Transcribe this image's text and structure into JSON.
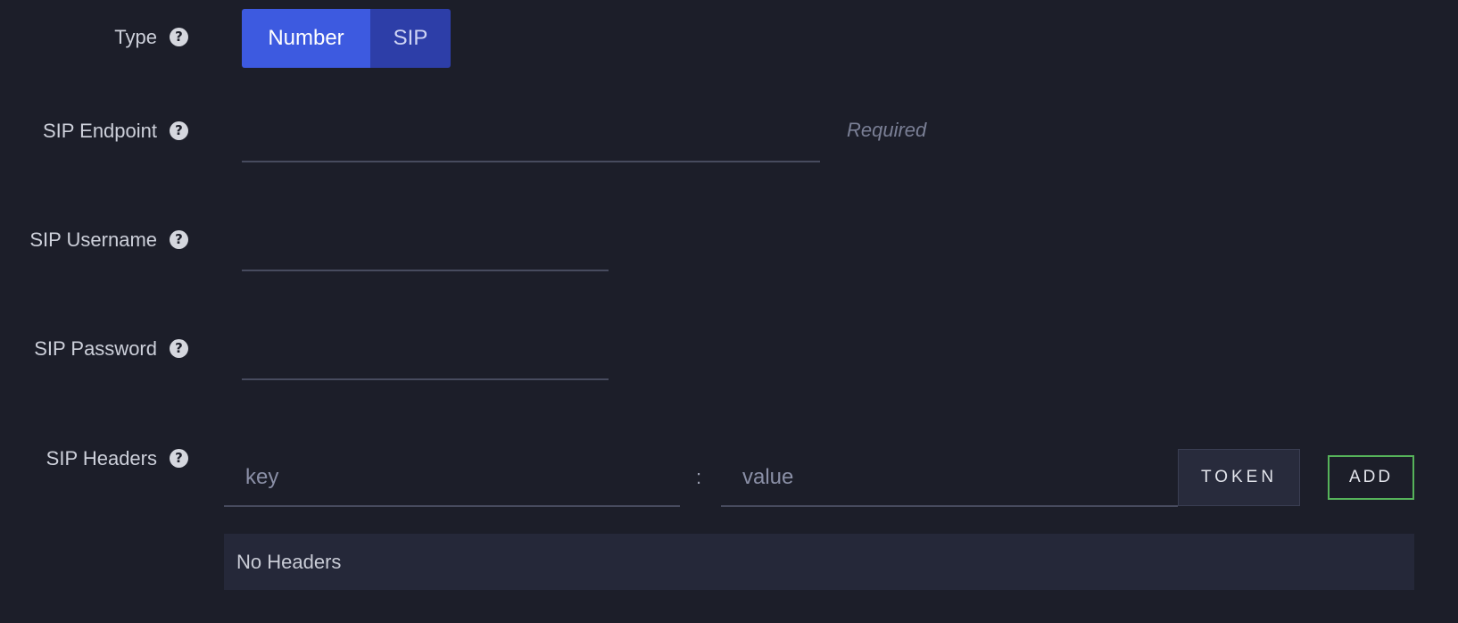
{
  "form": {
    "type": {
      "label": "Type",
      "options": [
        "Number",
        "SIP"
      ],
      "selected": "Number"
    },
    "sip_endpoint": {
      "label": "SIP Endpoint",
      "value": "",
      "hint": "Required"
    },
    "sip_username": {
      "label": "SIP Username",
      "value": ""
    },
    "sip_password": {
      "label": "SIP Password",
      "value": ""
    },
    "sip_headers": {
      "label": "SIP Headers",
      "key_placeholder": "key",
      "separator": ":",
      "value_placeholder": "value",
      "token_label": "TOKEN",
      "add_label": "ADD",
      "empty_text": "No Headers"
    }
  },
  "colors": {
    "background": "#1c1e29",
    "accent": "#3d5ae0",
    "add_border": "#56b35a"
  },
  "icons": {
    "help": "question-circle-icon"
  }
}
